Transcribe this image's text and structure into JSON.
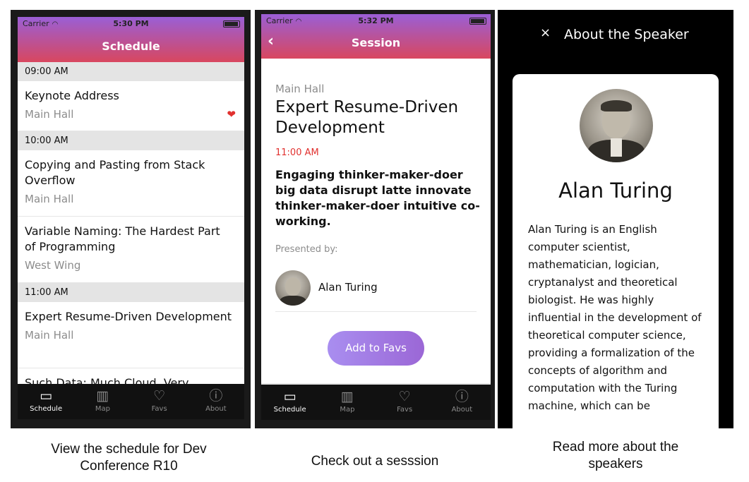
{
  "screen1": {
    "status": {
      "carrier": "Carrier",
      "time": "5:30 PM"
    },
    "nav_title": "Schedule",
    "slots": [
      {
        "time": "09:00 AM"
      },
      {
        "time": "10:00 AM"
      },
      {
        "time": "11:00 AM"
      }
    ],
    "talks": [
      {
        "title": "Keynote Address",
        "location": "Main Hall"
      },
      {
        "title": "Copying and Pasting from Stack Overflow",
        "location": "Main Hall"
      },
      {
        "title": "Variable Naming: The Hardest Part of Programming",
        "location": "West Wing"
      },
      {
        "title": "Expert Resume-Driven Development",
        "location": "Main Hall"
      },
      {
        "title": "Such Data: Much Cloud. Very",
        "location": ""
      }
    ],
    "tabs": [
      {
        "label": "Schedule",
        "icon": "calendar-icon"
      },
      {
        "label": "Map",
        "icon": "map-icon"
      },
      {
        "label": "Favs",
        "icon": "heart-icon"
      },
      {
        "label": "About",
        "icon": "info-icon"
      }
    ],
    "caption": "View the schedule for Dev Conference R10"
  },
  "screen2": {
    "status": {
      "carrier": "Carrier",
      "time": "5:32 PM"
    },
    "nav_title": "Session",
    "location": "Main Hall",
    "title": "Expert Resume-Driven Development",
    "time": "11:00 AM",
    "description": "Engaging thinker-maker-doer big data disrupt latte innovate thinker-maker-doer intuitive co-working.",
    "presented_by": "Presented by:",
    "speaker_name": "Alan Turing",
    "fav_button": "Add to Favs",
    "tabs": [
      {
        "label": "Schedule",
        "icon": "calendar-icon"
      },
      {
        "label": "Map",
        "icon": "map-icon"
      },
      {
        "label": "Favs",
        "icon": "heart-icon"
      },
      {
        "label": "About",
        "icon": "info-icon"
      }
    ],
    "caption": "Check out a sesssion"
  },
  "screen3": {
    "close": "×",
    "header_title": "About the Speaker",
    "speaker_name": "Alan Turing",
    "bio": "Alan Turing is an English computer scientist, mathematician, logician, cryptanalyst and theoretical biologist. He was highly influential in the development of theoretical computer science, providing a formalization of the concepts of algorithm and computation with the Turing machine, which can be",
    "caption": "Read more about the speakers"
  },
  "colors": {
    "accent_red": "#e1312f",
    "gradient_top": "#9a5fd6",
    "gradient_bottom": "#d8475f"
  }
}
